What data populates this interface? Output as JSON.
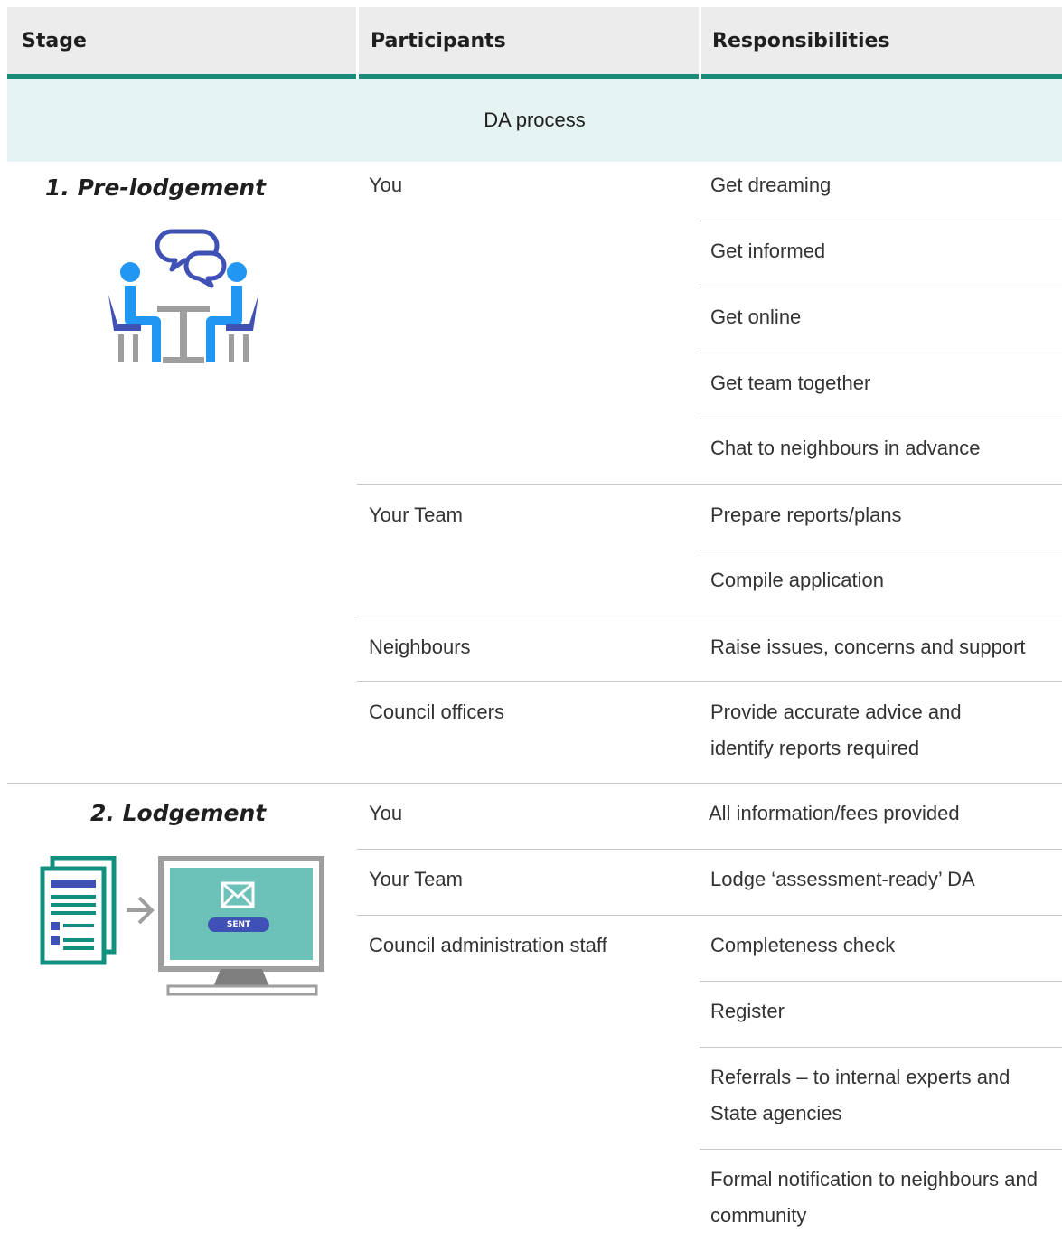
{
  "header": {
    "stage": "Stage",
    "participants": "Participants",
    "responsibilities": "Responsibilities"
  },
  "section_title": "DA process",
  "stages": [
    {
      "title": "1. Pre-lodgement",
      "icon": "meeting-people-icon",
      "groups": [
        {
          "participant": "You",
          "responsibilities": [
            "Get dreaming",
            "Get informed",
            "Get online",
            "Get team together",
            "Chat to neighbours in advance"
          ]
        },
        {
          "participant": "Your Team",
          "responsibilities": [
            "Prepare reports/plans",
            "Compile application"
          ]
        },
        {
          "participant": "Neighbours",
          "responsibilities": [
            "Raise issues, concerns and support"
          ]
        },
        {
          "participant": "Council officers",
          "responsibilities": [
            "Provide accurate advice and identify reports required"
          ]
        }
      ]
    },
    {
      "title": "2. Lodgement",
      "icon": "document-to-computer-icon",
      "icon_badge": "SENT",
      "groups": [
        {
          "participant": "You",
          "responsibilities": [
            "All information/fees provided"
          ]
        },
        {
          "participant": "Your Team",
          "responsibilities": [
            "Lodge ‘assessment-ready’ DA"
          ]
        },
        {
          "participant": "Council administration staff",
          "responsibilities": [
            "Completeness check",
            "Register",
            "Referrals – to internal experts and State agencies",
            "Formal notification to neighbours and community"
          ]
        }
      ]
    }
  ],
  "colors": {
    "accent": "#1a8a7a",
    "band": "#e6f3f3",
    "header_bg": "#ececec",
    "icon_blue": "#2196f3",
    "icon_indigo": "#3f51b5",
    "icon_grey": "#9e9e9e",
    "icon_teal": "#12907f",
    "screen": "#6cc1b8"
  }
}
